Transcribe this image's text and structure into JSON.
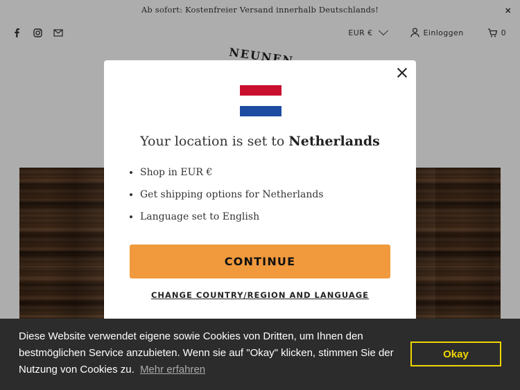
{
  "announcement": {
    "text": "Ab sofort: Kostenfreier Versand innerhalb Deutschlands!",
    "close": "×"
  },
  "header": {
    "social": [
      "facebook-icon",
      "instagram-icon",
      "mail-icon"
    ],
    "currency": "EUR €",
    "login": "Einloggen",
    "cart_count": "0",
    "logo_text": "NEUNEN"
  },
  "modal": {
    "flag_colors": [
      "#c8102e",
      "#ffffff",
      "#1e4ca1"
    ],
    "title_prefix": "Your location is set to ",
    "title_country": "Netherlands",
    "items": [
      "Shop in EUR €",
      "Get shipping options for Netherlands",
      "Language set to English"
    ],
    "continue_label": "CONTINUE",
    "change_label": "CHANGE COUNTRY/REGION AND LANGUAGE"
  },
  "cookie": {
    "text": "Diese Website verwendet eigene sowie Cookies von Dritten, um Ihnen den bestmöglichen Service anzubieten. Wenn sie auf \"Okay\" klicken, stimmen Sie der Nutzung von Cookies zu.",
    "link": "Mehr erfahren",
    "button": "Okay"
  },
  "colors": {
    "accent": "#f0993d",
    "cookie_bg": "#2c2c2c",
    "cookie_btn": "#f1d600"
  }
}
